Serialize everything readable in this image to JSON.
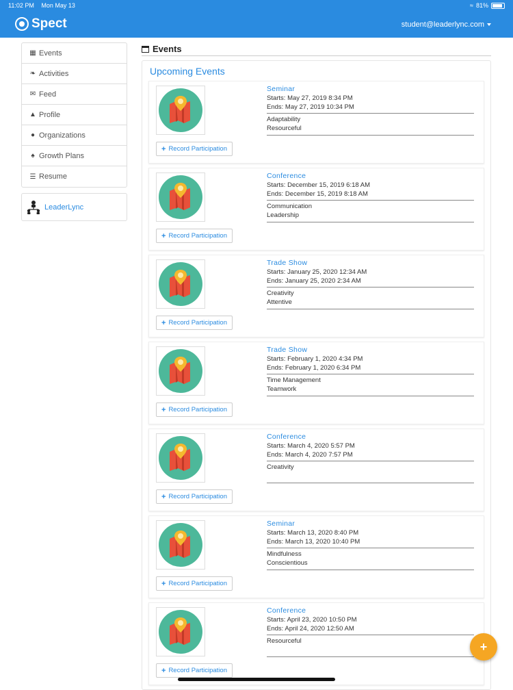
{
  "status": {
    "time": "11:02 PM",
    "date": "Mon May 13",
    "battery": "81%"
  },
  "header": {
    "brand": "Spect",
    "user": "student@leaderlync.com"
  },
  "sidebar": {
    "items": [
      {
        "label": "Events",
        "icon": "calendar-icon"
      },
      {
        "label": "Activities",
        "icon": "leaf-icon"
      },
      {
        "label": "Feed",
        "icon": "envelope-icon"
      },
      {
        "label": "Profile",
        "icon": "user-icon"
      },
      {
        "label": "Organizations",
        "icon": "apple-icon"
      },
      {
        "label": "Growth Plans",
        "icon": "tree-icon"
      },
      {
        "label": "Resume",
        "icon": "list-icon"
      }
    ],
    "org": {
      "label": "LeaderLync",
      "icon": "org-chart-icon"
    }
  },
  "main": {
    "title": "Events",
    "panel_title": "Upcoming Events",
    "record_label": "Record Participation",
    "events": [
      {
        "type": "Seminar",
        "starts": "Starts: May 27, 2019 8:34 PM",
        "ends": "Ends: May 27, 2019 10:34 PM",
        "skills": [
          "Adaptability",
          "Resourceful"
        ]
      },
      {
        "type": "Conference",
        "starts": "Starts: December 15, 2019 6:18 AM",
        "ends": "Ends: December 15, 2019 8:18 AM",
        "skills": [
          "Communication",
          "Leadership"
        ]
      },
      {
        "type": "Trade Show",
        "starts": "Starts: January 25, 2020 12:34 AM",
        "ends": "Ends: January 25, 2020 2:34 AM",
        "skills": [
          "Creativity",
          "Attentive"
        ]
      },
      {
        "type": "Trade Show",
        "starts": "Starts: February 1, 2020 4:34 PM",
        "ends": "Ends: February 1, 2020 6:34 PM",
        "skills": [
          "Time Management",
          "Teamwork"
        ]
      },
      {
        "type": "Conference",
        "starts": "Starts: March 4, 2020 5:57 PM",
        "ends": "Ends: March 4, 2020 7:57 PM",
        "skills": [
          "Creativity"
        ]
      },
      {
        "type": "Seminar",
        "starts": "Starts: March 13, 2020 8:40 PM",
        "ends": "Ends: March 13, 2020 10:40 PM",
        "skills": [
          "Mindfulness",
          "Conscientious"
        ]
      },
      {
        "type": "Conference",
        "starts": "Starts: April 23, 2020 10:50 PM",
        "ends": "Ends: April 24, 2020 12:50 AM",
        "skills": [
          "Resourceful"
        ]
      }
    ]
  },
  "fab": {
    "label": "+"
  },
  "colors": {
    "primary": "#2a8be0",
    "fab": "#f5a623",
    "thumb_circle": "#4db89a",
    "map_red": "#e8503a"
  }
}
